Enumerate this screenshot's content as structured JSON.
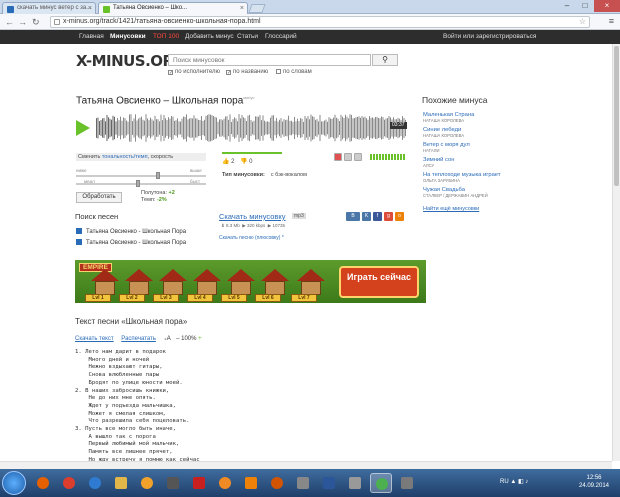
{
  "browser": {
    "tabs": [
      {
        "label": "скачать минус ветер с за...",
        "active": false
      },
      {
        "label": "Татьяна Овсиенко – Шко...",
        "active": true
      }
    ],
    "url": "x-minus.org/track/1421/татьяна-овсиенко-школьная-пора.html"
  },
  "sitenav": {
    "items": [
      "Главная",
      "Минусовки",
      "ТОП 100",
      "Добавить минус",
      "Статьи",
      "Глоссарий"
    ],
    "login": "Войти или зарегистрироваться"
  },
  "header": {
    "logo": "X-MINUS.ORG",
    "search_placeholder": "Поиск минусовок",
    "check_executor": "по исполнителю",
    "check_title": "по названию",
    "check_words": "по словам"
  },
  "track": {
    "title": "Татьяна Овсиенко – Школьная пора",
    "title_sup": "минус",
    "duration": "03:37",
    "ctrl_prefix": "Сменить ",
    "ctrl_link": "тональность/темп",
    "ctrl_suffix": ", скорость",
    "lbl_lower": "ниже",
    "lbl_higher": "выше",
    "lbl_slower": "медл",
    "lbl_faster": "быст",
    "process": "Обработать",
    "tone_label": "Полутона:",
    "tone_value": "+2",
    "tempo_label": "Темп:",
    "tempo_value": "-2%",
    "likes": "2",
    "dislikes": "0",
    "type_label": "Тип минусовки:",
    "type_value": "с бэк-вокалом",
    "download": "Скачать минусовку",
    "format": "mp3",
    "size": "8.3 Mb",
    "bitrate": "320 kbps",
    "downloads": "10735",
    "download_plus": "Скачать песню (плюсовку) *"
  },
  "song_search": {
    "title": "Поиск песен",
    "results": [
      "Татьяна Овсиенко - Школьная Пора",
      "Татьяна Овсиенко - Школьная Пора"
    ]
  },
  "banner": {
    "empire": "EMPIRE",
    "cta": "Играть сейчас",
    "levels": [
      "Lvl 1",
      "Lvl 2",
      "Lvl 3",
      "Lvl 4",
      "Lvl 5",
      "Lvl 6",
      "Lvl 7"
    ]
  },
  "lyrics": {
    "title": "Текст песни «Школьная пора»",
    "download": "Скачать текст",
    "print": "Распечатать",
    "size": "100%",
    "text": "1. Лето нам дарит в подарок\n    Много дней и ночей\n    Нежно вздыхают гитары,\n    Снова влюбленные пары\n    Бродят по улице юности моей.\n2. В наших забросишь книжки,\n    Не до них мне опять.\n    Ждет у подъезда мальчишка,\n    Может я смелая слишком,\n    Что разрешила себя поцеловать.\n3. Пусть все могло быть иначе,\n    А вышло так с порога\n    Первый любимый мой мальчик,\n    Память все лишнее прячет,\n    Но жду встречу я помню как сейчас\nПРИПЕВ\n    Школьная пора и при всякой погоде"
  },
  "sidebar": {
    "title": "Похожие минуса",
    "items": [
      {
        "song": "Маленькая Страна",
        "artist": "НАТАША КОРОЛЕВА"
      },
      {
        "song": "Синие лебеди",
        "artist": "НАТАША КОРОЛЕВА"
      },
      {
        "song": "Ветер с моря дул",
        "artist": "НАТАЛИ"
      },
      {
        "song": "Зимний сон",
        "artist": "АЛСУ"
      },
      {
        "song": "На теплоходе музыка играет",
        "artist": "ОЛЬГА ЗАРУБИНА"
      },
      {
        "song": "Чужая Свадьба",
        "artist": "СТАЛКЕР / ДЕРЖАВИН АНДРЕЙ"
      }
    ],
    "more": "Найти ещё минусовки"
  },
  "taskbar": {
    "lang": "RU",
    "time": "12:56",
    "date": "24.09.2014"
  }
}
